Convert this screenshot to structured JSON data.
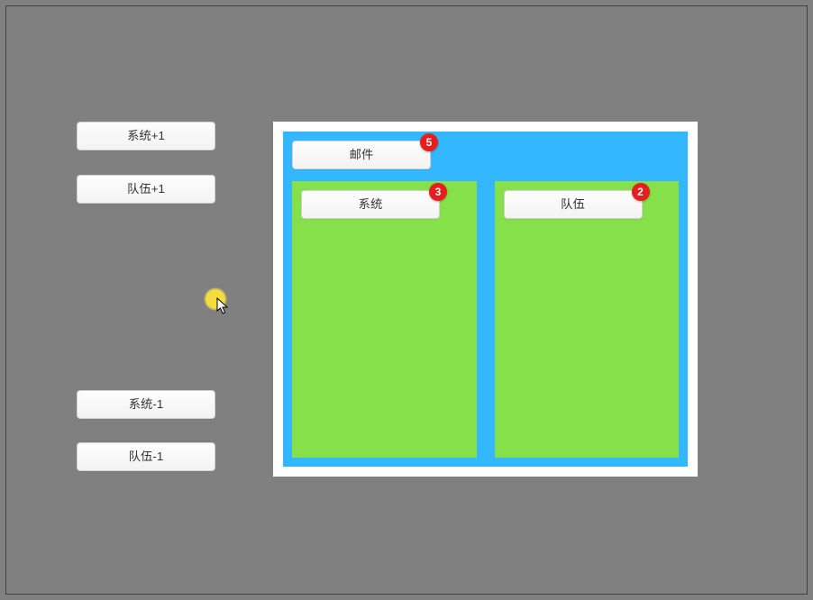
{
  "controls": {
    "sys_plus": "系统+1",
    "team_plus": "队伍+1",
    "sys_minus": "系统-1",
    "team_minus": "队伍-1"
  },
  "mail": {
    "label": "邮件",
    "badge": "5"
  },
  "system_panel": {
    "label": "系统",
    "badge": "3"
  },
  "team_panel": {
    "label": "队伍",
    "badge": "2"
  },
  "colors": {
    "bg": "#808080",
    "panel_blue": "#33b7ff",
    "panel_green": "#86e049",
    "badge_red": "#e81d1d"
  }
}
